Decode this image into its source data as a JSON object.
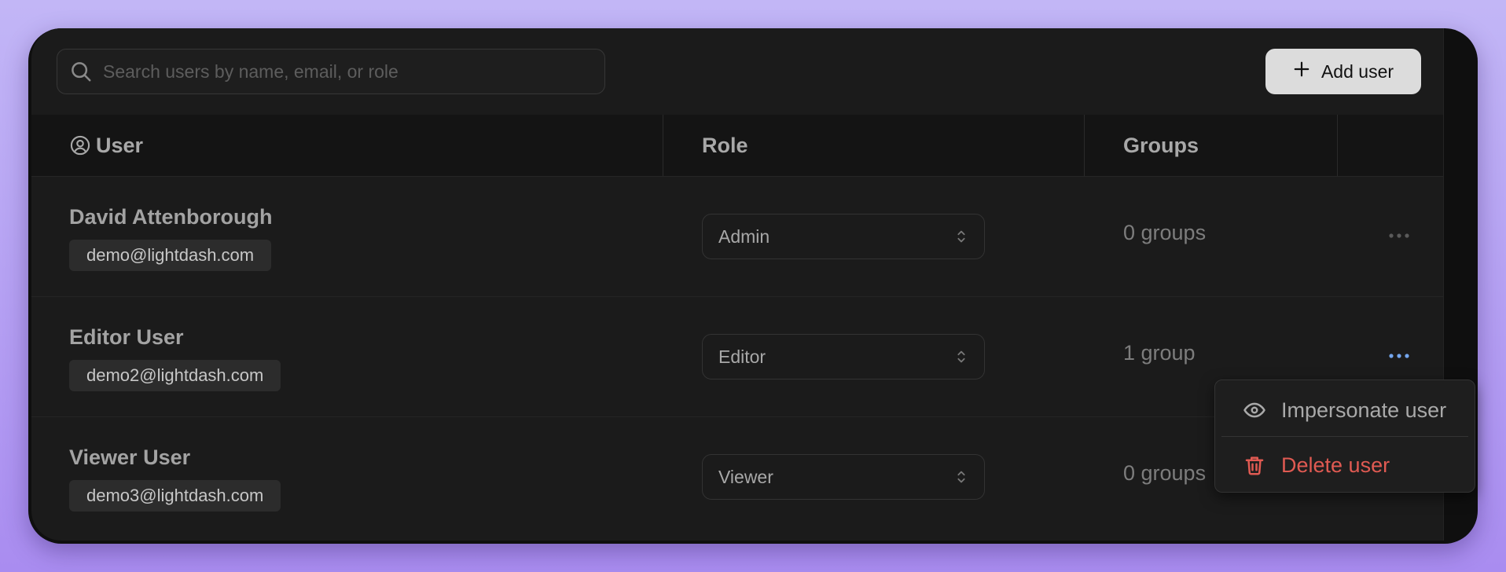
{
  "search": {
    "placeholder": "Search users by name, email, or role"
  },
  "toolbar": {
    "add_user_label": "Add user"
  },
  "table": {
    "headers": {
      "user": "User",
      "role": "Role",
      "groups": "Groups"
    },
    "rows": [
      {
        "name": "David Attenborough",
        "email": "demo@lightdash.com",
        "role": "Admin",
        "groups": "0 groups"
      },
      {
        "name": "Editor User",
        "email": "demo2@lightdash.com",
        "role": "Editor",
        "groups": "1 group"
      },
      {
        "name": "Viewer User",
        "email": "demo3@lightdash.com",
        "role": "Viewer",
        "groups": "0 groups"
      }
    ]
  },
  "menu": {
    "impersonate_label": "Impersonate user",
    "delete_label": "Delete user"
  },
  "colors": {
    "background_top": "#c2b6f6",
    "background_bottom": "#a98cf0",
    "panel": "#1b1b1b",
    "accent_blue": "#74a6ee",
    "danger": "#e05a52"
  },
  "icons": {
    "search": "search-icon",
    "add": "plus-icon",
    "user_header": "user-circle-icon",
    "role_select": "selector-chevrons-icon",
    "row_actions": "dots-icon",
    "impersonate": "eye-icon",
    "delete": "trash-icon"
  }
}
